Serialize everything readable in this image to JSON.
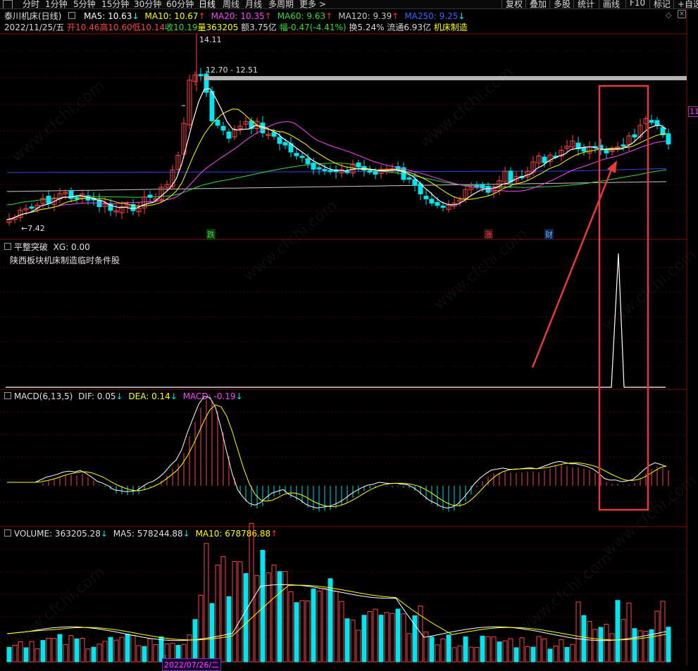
{
  "toolbar": {
    "period_tabs": [
      "分时",
      "1分钟",
      "5分钟",
      "15分钟",
      "30分钟",
      "60分钟",
      "日线",
      "周线",
      "月线",
      "多周期",
      "更多 >"
    ],
    "active_tab": "日线",
    "right_buttons": [
      "复权",
      "叠加",
      "多股",
      "统计",
      "画线",
      "F10",
      "标记",
      "+自选"
    ]
  },
  "main_chart": {
    "title": "泰川机床(日线)",
    "ma_legend": [
      {
        "label": "MA5: 10.63",
        "arrow": "↓",
        "color": "#ffffff",
        "arrow_color": "#00ffff"
      },
      {
        "label": "MA10: 10.67",
        "arrow": "↑",
        "color": "#ffff00",
        "arrow_color": "#ff3333"
      },
      {
        "label": "MA20: 10.35",
        "arrow": "↑",
        "color": "#ff44ff",
        "arrow_color": "#ff3333"
      },
      {
        "label": "MA60: 9.63",
        "arrow": "↑",
        "color": "#33dd33",
        "arrow_color": "#ff3333"
      },
      {
        "label": "MA120: 9.39",
        "arrow": "↑",
        "color": "#c8c8c8",
        "arrow_color": "#ff3333"
      },
      {
        "label": "MA250: 9.25",
        "arrow": "↓",
        "color": "#3366ff",
        "arrow_color": "#00ffff"
      }
    ],
    "date": "2022/11/25/五",
    "open": "开10.46",
    "high": "高10.60",
    "low": "低10.14",
    "close": "收10.19",
    "volume": "量363205",
    "amount": "额3.75亿",
    "change": "幅-0.47(-4.41%)",
    "turnover": "换5.24%",
    "float": "流通6.93亿",
    "sector": "机床制造",
    "high_label": "14.11",
    "low_label": "←7.42",
    "range_label": "12.70 - 12.51",
    "markers": [
      "跌",
      "涨",
      "财"
    ],
    "right_price": "11"
  },
  "indicator": {
    "title": "平整突破",
    "xg": "XG: 0.00",
    "note": "陕西板块机床制造临时条件股"
  },
  "macd": {
    "title": "MACD(6,13,5)",
    "dif": "DIF: 0.05",
    "dif_arrow": "↓",
    "dea": "DEA: 0.14",
    "dea_arrow": "↓",
    "macd": "MACD: -0.19",
    "macd_arrow": "↓"
  },
  "volume": {
    "title": "VOLUME: 363205.28",
    "title_arrow": "↓",
    "ma5": "MA5: 578244.88",
    "ma5_arrow": "↓",
    "ma10": "MA10: 678786.88",
    "ma10_arrow": "↑",
    "bottom_date": "2022/07/26/二"
  },
  "watermark": "www.cfchi.com",
  "colors": {
    "up": "#ff4444",
    "down": "#00e5ee",
    "highlight_box": "#e63b3b",
    "resistance_line": "#b4b4b4",
    "panel_border": "#7a1010"
  }
}
